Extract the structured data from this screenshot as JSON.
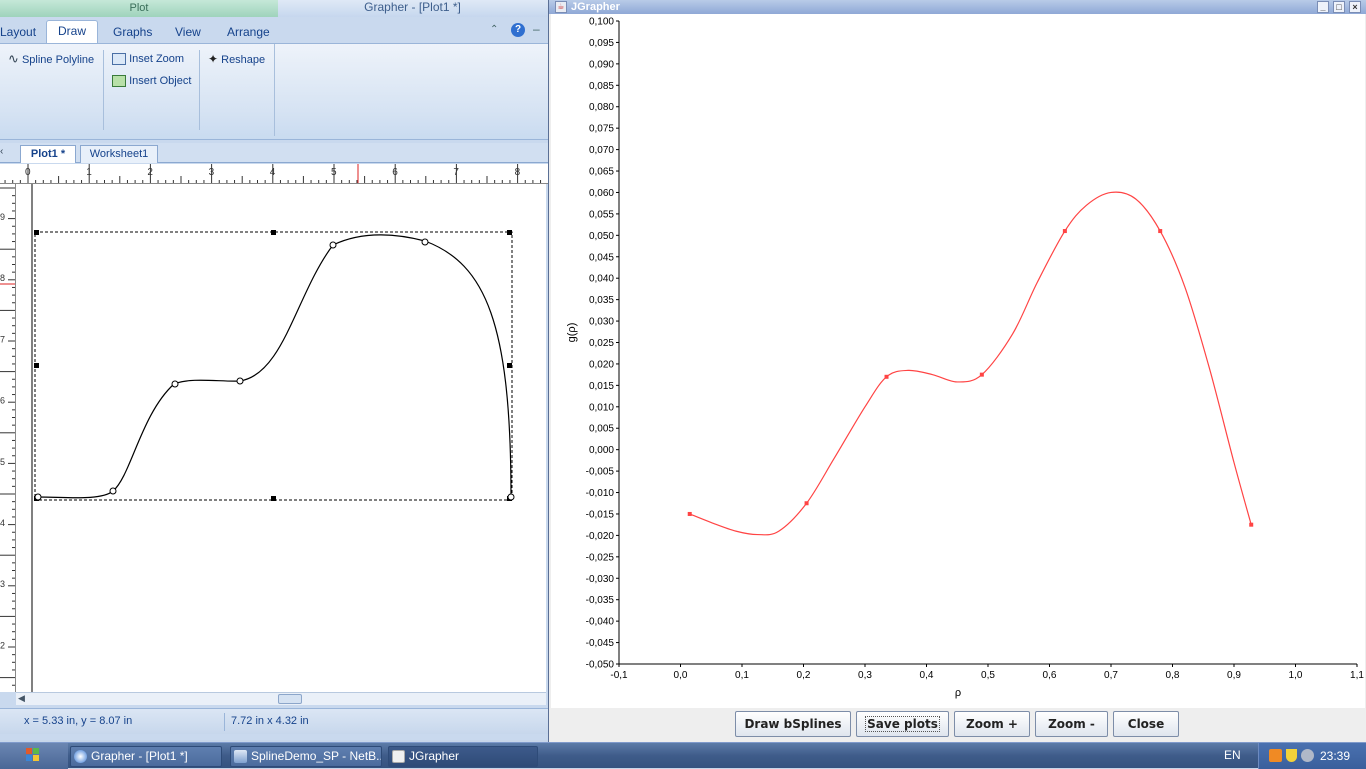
{
  "grapher": {
    "context_tab": "Plot",
    "window_title": "Grapher - [Plot1 *]",
    "ribbon_tabs": [
      {
        "label": "Layout"
      },
      {
        "label": "Draw"
      },
      {
        "label": "Graphs"
      },
      {
        "label": "View"
      },
      {
        "label": "Arrange"
      }
    ],
    "ribbon_buttons": {
      "spline_polyline": "Spline Polyline",
      "inset_zoom": "Inset Zoom",
      "insert_object": "Insert Object",
      "reshape": "Reshape"
    },
    "doc_tabs": [
      "Plot1 *",
      "Worksheet1"
    ],
    "ruler_h_labels": [
      "0",
      "1",
      "2",
      "3",
      "4",
      "5",
      "6",
      "7",
      "8"
    ],
    "ruler_v_labels": [
      "9",
      "8",
      "7",
      "6",
      "5",
      "4",
      "3",
      "2"
    ],
    "status": {
      "cursor": "x = 5.33 in, y = 8.07 in",
      "size": "7.72 in x 4.32 in"
    }
  },
  "jgrapher": {
    "window_title": "JGrapher",
    "buttons": {
      "draw_bsplines": "Draw bSplines",
      "save_plots": "Save plots",
      "zoom_in": "Zoom +",
      "zoom_out": "Zoom -",
      "close": "Close"
    }
  },
  "chart_data": {
    "type": "line",
    "title": "",
    "xlabel": "ρ",
    "ylabel": "g(ρ)",
    "xlim": [
      -0.1,
      1.1
    ],
    "ylim": [
      -0.05,
      0.1
    ],
    "x_ticks": [
      "-0,1",
      "0,0",
      "0,1",
      "0,2",
      "0,3",
      "0,4",
      "0,5",
      "0,6",
      "0,7",
      "0,8",
      "0,9",
      "1,0",
      "1,1"
    ],
    "y_ticks": [
      "-0,050",
      "-0,045",
      "-0,040",
      "-0,035",
      "-0,030",
      "-0,025",
      "-0,020",
      "-0,015",
      "-0,010",
      "-0,005",
      "0,000",
      "0,005",
      "0,010",
      "0,015",
      "0,020",
      "0,025",
      "0,030",
      "0,035",
      "0,040",
      "0,045",
      "0,050",
      "0,055",
      "0,060",
      "0,065",
      "0,070",
      "0,075",
      "0,080",
      "0,085",
      "0,090",
      "0,095",
      "0,100"
    ],
    "grid": false,
    "line_color": "#ff4444",
    "control_points": [
      {
        "x": 0.015,
        "y": -0.015
      },
      {
        "x": 0.205,
        "y": -0.0125
      },
      {
        "x": 0.335,
        "y": 0.017
      },
      {
        "x": 0.49,
        "y": 0.0175
      },
      {
        "x": 0.625,
        "y": 0.051
      },
      {
        "x": 0.78,
        "y": 0.051
      },
      {
        "x": 0.928,
        "y": -0.0175
      }
    ],
    "curve": [
      {
        "x": 0.015,
        "y": -0.015
      },
      {
        "x": 0.05,
        "y": -0.017
      },
      {
        "x": 0.09,
        "y": -0.019
      },
      {
        "x": 0.125,
        "y": -0.0198
      },
      {
        "x": 0.16,
        "y": -0.019
      },
      {
        "x": 0.205,
        "y": -0.0125
      },
      {
        "x": 0.25,
        "y": -0.002
      },
      {
        "x": 0.3,
        "y": 0.01
      },
      {
        "x": 0.335,
        "y": 0.017
      },
      {
        "x": 0.37,
        "y": 0.0185
      },
      {
        "x": 0.41,
        "y": 0.0175
      },
      {
        "x": 0.45,
        "y": 0.0158
      },
      {
        "x": 0.49,
        "y": 0.0175
      },
      {
        "x": 0.54,
        "y": 0.027
      },
      {
        "x": 0.58,
        "y": 0.039
      },
      {
        "x": 0.625,
        "y": 0.051
      },
      {
        "x": 0.66,
        "y": 0.057
      },
      {
        "x": 0.7,
        "y": 0.06
      },
      {
        "x": 0.74,
        "y": 0.0585
      },
      {
        "x": 0.78,
        "y": 0.051
      },
      {
        "x": 0.82,
        "y": 0.038
      },
      {
        "x": 0.86,
        "y": 0.019
      },
      {
        "x": 0.9,
        "y": -0.003
      },
      {
        "x": 0.928,
        "y": -0.0175
      }
    ]
  },
  "taskbar": {
    "items": [
      {
        "label": "Grapher - [Plot1 *]"
      },
      {
        "label": "SplineDemo_SP - NetB..."
      },
      {
        "label": "JGrapher"
      }
    ],
    "language": "EN",
    "clock": "23:39"
  }
}
